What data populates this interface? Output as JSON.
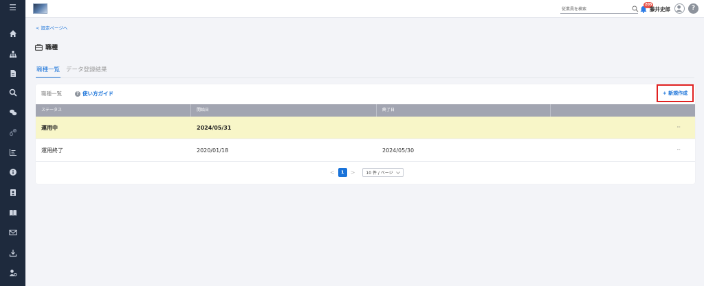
{
  "sidebar": {
    "items": [
      {
        "icon": "menu-icon"
      },
      {
        "icon": "home-icon"
      },
      {
        "icon": "org-chart-icon"
      },
      {
        "icon": "document-icon"
      },
      {
        "icon": "search-icon"
      },
      {
        "icon": "chat-icon"
      },
      {
        "icon": "link-icon"
      },
      {
        "icon": "bar-chart-icon"
      },
      {
        "icon": "info-icon"
      },
      {
        "icon": "contact-book-icon"
      },
      {
        "icon": "book-icon"
      },
      {
        "icon": "mail-icon"
      },
      {
        "icon": "download-icon"
      },
      {
        "icon": "user-settings-icon"
      }
    ]
  },
  "header": {
    "search_placeholder": "従業員を検索",
    "notification_count": "205",
    "user_name": "藤井史郎",
    "help_label": "?"
  },
  "nav": {
    "back_label": "< 設定ページへ"
  },
  "page": {
    "title": "職種"
  },
  "tabs": [
    {
      "label": "職種一覧",
      "active": true
    },
    {
      "label": "データ登録結果",
      "active": false
    }
  ],
  "card": {
    "list_label": "職種一覧",
    "guide_label": "使い方ガイド",
    "guide_icon": "?",
    "new_button_label": "+ 新規作成"
  },
  "table": {
    "columns": [
      "ステータス",
      "開始日",
      "終了日",
      ""
    ],
    "rows": [
      {
        "status": "運用中",
        "start": "2024/05/31",
        "end": "",
        "more": "···",
        "highlight": true
      },
      {
        "status": "運用終了",
        "start": "2020/01/18",
        "end": "2024/05/30",
        "more": "···",
        "highlight": false
      }
    ]
  },
  "pagination": {
    "prev": "<",
    "current": "1",
    "next": ">",
    "page_size": "10 件 / ページ"
  },
  "colors": {
    "sidebar_bg": "#1e2a3d",
    "accent": "#1a73d9",
    "highlight_row": "#f8f6c8",
    "table_header": "#a2a5b1",
    "new_button_border": "#e02020",
    "badge": "#e8534a"
  }
}
